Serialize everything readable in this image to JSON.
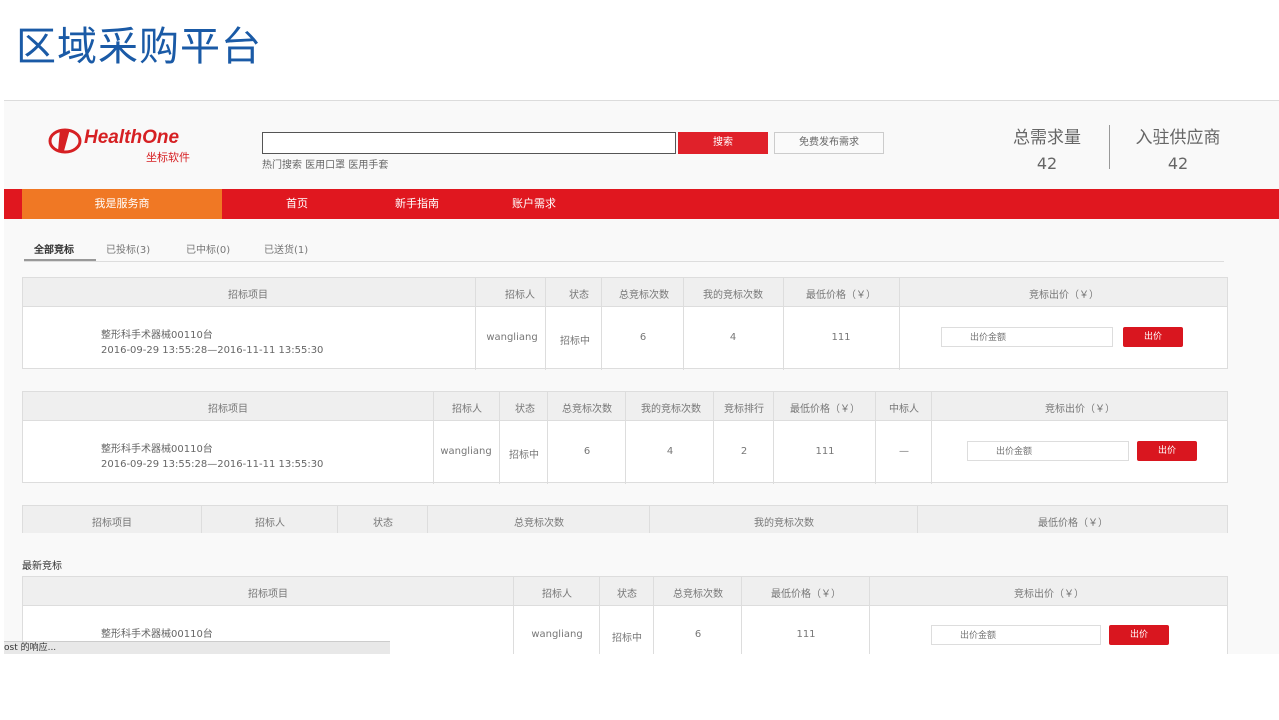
{
  "slide_title": "区域采购平台",
  "logo": {
    "brand": "HealthOne",
    "sub": "坐标软件"
  },
  "search": {
    "placeholder": "",
    "button": "搜索",
    "publish": "免费发布需求",
    "hot": "热门搜索 医用口罩 医用手套"
  },
  "stats": [
    {
      "label": "总需求量",
      "value": "42"
    },
    {
      "label": "入驻供应商",
      "value": "42"
    }
  ],
  "nav": [
    "我是服务商",
    "首页",
    "新手指南",
    "账户需求"
  ],
  "tabs": [
    "全部竞标",
    "已投标(3)",
    "已中标(0)",
    "已送货(1)"
  ],
  "table1": {
    "headers": [
      "招标项目",
      "招标人",
      "状态",
      "总竞标次数",
      "我的竞标次数",
      "最低价格（￥）",
      "竞标出价（￥）"
    ],
    "row": {
      "project": "整形科手术器械00110台",
      "period": "2016-09-29 13:55:28—2016-11-11 13:55:30",
      "tenderer": "wangliang",
      "status": "招标中",
      "total": "6",
      "mine": "4",
      "lowest": "111",
      "amount_placeholder": "出价金额",
      "bid": "出价"
    }
  },
  "table2": {
    "headers": [
      "招标项目",
      "招标人",
      "状态",
      "总竞标次数",
      "我的竞标次数",
      "竞标排行",
      "最低价格（￥）",
      "中标人",
      "竞标出价（￥）"
    ],
    "row": {
      "project": "整形科手术器械00110台",
      "period": "2016-09-29 13:55:28—2016-11-11 13:55:30",
      "tenderer": "wangliang",
      "status": "招标中",
      "total": "6",
      "mine": "4",
      "rank": "2",
      "lowest": "111",
      "winner": "—",
      "amount_placeholder": "出价金额",
      "bid": "出价"
    }
  },
  "table3": {
    "headers": [
      "招标项目",
      "招标人",
      "状态",
      "总竞标次数",
      "我的竞标次数",
      "最低价格（￥）"
    ]
  },
  "latest_title": "最新竞标",
  "table4": {
    "headers": [
      "招标项目",
      "招标人",
      "状态",
      "总竞标次数",
      "最低价格（￥）",
      "竞标出价（￥）"
    ],
    "row": {
      "project": "整形科手术器械00110台",
      "tenderer": "wangliang",
      "status": "招标中",
      "total": "6",
      "lowest": "111",
      "amount_placeholder": "出价金额",
      "bid": "出价"
    }
  },
  "status_bar": "ost 的响应..."
}
